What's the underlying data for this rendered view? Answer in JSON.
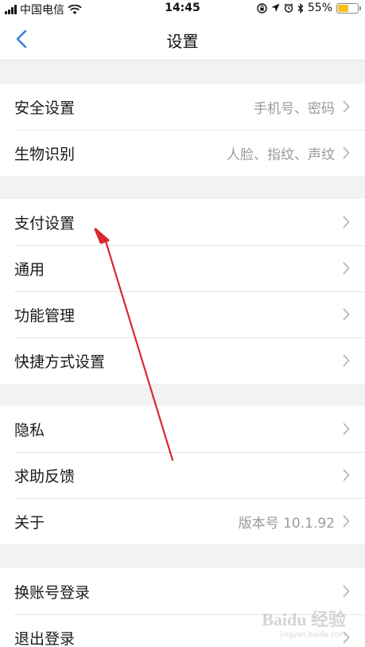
{
  "status_bar": {
    "carrier": "中国电信",
    "time": "14:45",
    "battery_percent": "55%",
    "battery_level": 0.55,
    "battery_color": "#f4c21b"
  },
  "nav": {
    "title": "设置",
    "back_icon": "chevron-left-icon",
    "accent_color": "#2f7de0"
  },
  "groups": [
    {
      "items": [
        {
          "label": "安全设置",
          "detail": "手机号、密码"
        },
        {
          "label": "生物识别",
          "detail": "人脸、指纹、声纹"
        }
      ]
    },
    {
      "items": [
        {
          "label": "支付设置",
          "detail": ""
        },
        {
          "label": "通用",
          "detail": ""
        },
        {
          "label": "功能管理",
          "detail": ""
        },
        {
          "label": "快捷方式设置",
          "detail": ""
        }
      ]
    },
    {
      "items": [
        {
          "label": "隐私",
          "detail": ""
        },
        {
          "label": "求助反馈",
          "detail": ""
        },
        {
          "label": "关于",
          "detail": "版本号 10.1.92"
        }
      ]
    },
    {
      "items": [
        {
          "label": "换账号登录",
          "detail": ""
        },
        {
          "label": "退出登录",
          "detail": ""
        }
      ]
    }
  ],
  "watermark": {
    "logo": "Baidu 经验",
    "url": "jingyan.baidu.com"
  },
  "annotation": {
    "color": "#d9282f",
    "icon": "red-arrow-annotation"
  }
}
